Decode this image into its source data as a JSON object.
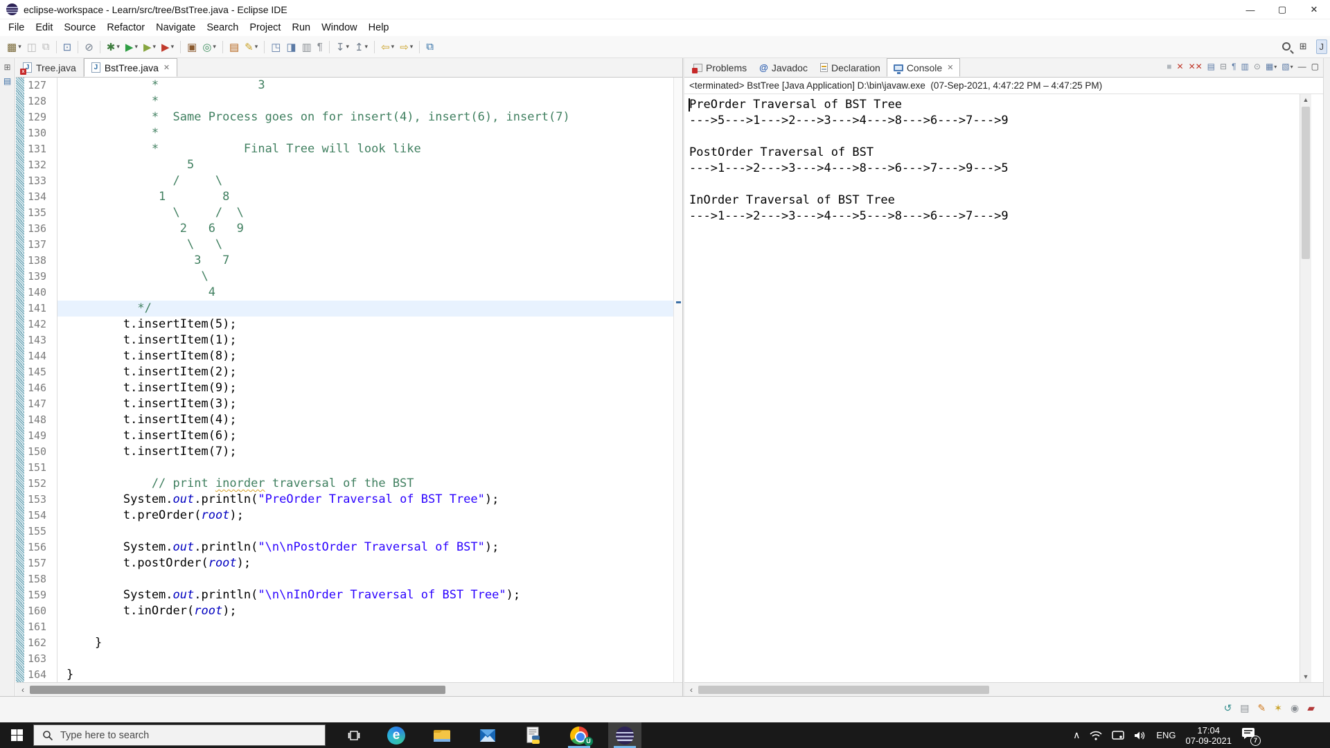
{
  "titlebar": {
    "title": "eclipse-workspace - Learn/src/tree/BstTree.java - Eclipse IDE"
  },
  "window_controls": {
    "minimize": "—",
    "maximize": "▢",
    "close": "✕"
  },
  "menus": [
    "File",
    "Edit",
    "Source",
    "Refactor",
    "Navigate",
    "Search",
    "Project",
    "Run",
    "Window",
    "Help"
  ],
  "toolbar": [
    {
      "name": "new",
      "g": "▩",
      "c": "#7a6a3a",
      "dd": true
    },
    {
      "name": "save",
      "g": "◫",
      "c": "#b8b8b8"
    },
    {
      "name": "save-all",
      "g": "⧉",
      "c": "#b8b8b8"
    },
    {
      "sep": true
    },
    {
      "name": "open-console-tool",
      "g": "⊡",
      "c": "#5b7aa5"
    },
    {
      "sep": true
    },
    {
      "name": "skip-breakpoints",
      "g": "⊘",
      "c": "#6f7b8a"
    },
    {
      "sep": true
    },
    {
      "name": "debug",
      "g": "✱",
      "c": "#3e7d3e",
      "dd": true
    },
    {
      "name": "run",
      "g": "▶",
      "c": "#2f9e44",
      "dd": true
    },
    {
      "name": "coverage",
      "g": "▶",
      "c": "#86a53f",
      "dd": true
    },
    {
      "name": "profile",
      "g": "▶",
      "c": "#c0392b",
      "dd": true
    },
    {
      "sep": true
    },
    {
      "name": "new-java-project",
      "g": "▣",
      "c": "#8a5a2e"
    },
    {
      "name": "new-class",
      "g": "◎",
      "c": "#3f8f5f",
      "dd": true
    },
    {
      "sep": true
    },
    {
      "name": "open-task",
      "g": "▤",
      "c": "#b5651d"
    },
    {
      "name": "highlight",
      "g": "✎",
      "c": "#c9a227",
      "dd": true
    },
    {
      "sep": true
    },
    {
      "name": "snapshot",
      "g": "◳",
      "c": "#5b7aa5"
    },
    {
      "name": "pin-editor",
      "g": "◨",
      "c": "#5b7aa5"
    },
    {
      "name": "show-annotations",
      "g": "▥",
      "c": "#8a8f94"
    },
    {
      "name": "show-whitespace",
      "g": "¶",
      "c": "#8a8f94"
    },
    {
      "sep": true
    },
    {
      "name": "next-annotation",
      "g": "↧",
      "c": "#6f7b8a",
      "dd": true
    },
    {
      "name": "prev-annotation",
      "g": "↥",
      "c": "#6f7b8a",
      "dd": true
    },
    {
      "sep": true
    },
    {
      "name": "back",
      "g": "⇦",
      "c": "#c9a227",
      "dd": true
    },
    {
      "name": "forward",
      "g": "⇨",
      "c": "#c9a227",
      "dd": true
    },
    {
      "sep": true
    },
    {
      "name": "link-editor",
      "g": "⧉",
      "c": "#2e6da4"
    }
  ],
  "perspectives": {
    "open_label": "⊞",
    "java_label": "J"
  },
  "left_strip_icons": [
    {
      "name": "restore-panel",
      "g": "⊞",
      "c": "#666"
    },
    {
      "name": "package-explorer",
      "g": "▤",
      "c": "#3a6ea5"
    }
  ],
  "editor": {
    "tabs": [
      {
        "name": "tab-tree-java",
        "label": "Tree.java",
        "active": false,
        "error": true,
        "close": false
      },
      {
        "name": "tab-bsttree-java",
        "label": "BstTree.java",
        "active": true,
        "error": false,
        "close": true,
        "close_glyph": "✕"
      }
    ],
    "file_icon_letter": "J",
    "error_badge": "x",
    "current_line": 141,
    "lines": [
      {
        "n": 127,
        "segs": [
          [
            "cm",
            "            *              3"
          ]
        ]
      },
      {
        "n": 128,
        "segs": [
          [
            "cm",
            "            *"
          ]
        ]
      },
      {
        "n": 129,
        "segs": [
          [
            "cm",
            "            *  Same Process goes on for insert(4), insert(6), insert(7)"
          ]
        ]
      },
      {
        "n": 130,
        "segs": [
          [
            "cm",
            "            *"
          ]
        ]
      },
      {
        "n": 131,
        "segs": [
          [
            "cm",
            "            *            Final Tree will look like"
          ]
        ]
      },
      {
        "n": 132,
        "segs": [
          [
            "cm",
            "                 5"
          ]
        ]
      },
      {
        "n": 133,
        "segs": [
          [
            "cm",
            "               /     \\"
          ]
        ]
      },
      {
        "n": 134,
        "segs": [
          [
            "cm",
            "             1        8"
          ]
        ]
      },
      {
        "n": 135,
        "segs": [
          [
            "cm",
            "               \\     /  \\"
          ]
        ]
      },
      {
        "n": 136,
        "segs": [
          [
            "cm",
            "                2   6   9"
          ]
        ]
      },
      {
        "n": 137,
        "segs": [
          [
            "cm",
            "                 \\   \\"
          ]
        ]
      },
      {
        "n": 138,
        "segs": [
          [
            "cm",
            "                  3   7"
          ]
        ]
      },
      {
        "n": 139,
        "segs": [
          [
            "cm",
            "                   \\"
          ]
        ]
      },
      {
        "n": 140,
        "segs": [
          [
            "cm",
            "                    4"
          ]
        ]
      },
      {
        "n": 141,
        "segs": [
          [
            "cm",
            "          */"
          ]
        ]
      },
      {
        "n": 142,
        "segs": [
          [
            "pl",
            "        t.insertItem(5);"
          ]
        ]
      },
      {
        "n": 143,
        "segs": [
          [
            "pl",
            "        t.insertItem(1);"
          ]
        ]
      },
      {
        "n": 144,
        "segs": [
          [
            "pl",
            "        t.insertItem(8);"
          ]
        ]
      },
      {
        "n": 145,
        "segs": [
          [
            "pl",
            "        t.insertItem(2);"
          ]
        ]
      },
      {
        "n": 146,
        "segs": [
          [
            "pl",
            "        t.insertItem(9);"
          ]
        ]
      },
      {
        "n": 147,
        "segs": [
          [
            "pl",
            "        t.insertItem(3);"
          ]
        ]
      },
      {
        "n": 148,
        "segs": [
          [
            "pl",
            "        t.insertItem(4);"
          ]
        ]
      },
      {
        "n": 149,
        "segs": [
          [
            "pl",
            "        t.insertItem(6);"
          ]
        ]
      },
      {
        "n": 150,
        "segs": [
          [
            "pl",
            "        t.insertItem(7);"
          ]
        ]
      },
      {
        "n": 151,
        "segs": []
      },
      {
        "n": 152,
        "segs": [
          [
            "cm",
            "            // print "
          ],
          [
            "cmw",
            "inorder"
          ],
          [
            "cm",
            " traversal of the BST"
          ]
        ]
      },
      {
        "n": 153,
        "segs": [
          [
            "pl",
            "        System."
          ],
          [
            "fd",
            "out"
          ],
          [
            "pl",
            ".println("
          ],
          [
            "st",
            "\"PreOrder Traversal of BST Tree\""
          ],
          [
            "pl",
            ");"
          ]
        ]
      },
      {
        "n": 154,
        "segs": [
          [
            "pl",
            "        t.preOrder("
          ],
          [
            "fd",
            "root"
          ],
          [
            "pl",
            ");"
          ]
        ]
      },
      {
        "n": 155,
        "segs": []
      },
      {
        "n": 156,
        "segs": [
          [
            "pl",
            "        System."
          ],
          [
            "fd",
            "out"
          ],
          [
            "pl",
            ".println("
          ],
          [
            "st",
            "\"\\n\\nPostOrder Traversal of BST\""
          ],
          [
            "pl",
            ");"
          ]
        ]
      },
      {
        "n": 157,
        "segs": [
          [
            "pl",
            "        t.postOrder("
          ],
          [
            "fd",
            "root"
          ],
          [
            "pl",
            ");"
          ]
        ]
      },
      {
        "n": 158,
        "segs": []
      },
      {
        "n": 159,
        "segs": [
          [
            "pl",
            "        System."
          ],
          [
            "fd",
            "out"
          ],
          [
            "pl",
            ".println("
          ],
          [
            "st",
            "\"\\n\\nInOrder Traversal of BST Tree\""
          ],
          [
            "pl",
            ");"
          ]
        ]
      },
      {
        "n": 160,
        "segs": [
          [
            "pl",
            "        t.inOrder("
          ],
          [
            "fd",
            "root"
          ],
          [
            "pl",
            ");"
          ]
        ]
      },
      {
        "n": 161,
        "segs": []
      },
      {
        "n": 162,
        "segs": [
          [
            "pl",
            "    }"
          ]
        ]
      },
      {
        "n": 163,
        "segs": []
      },
      {
        "n": 164,
        "segs": [
          [
            "pl",
            "}"
          ]
        ]
      }
    ]
  },
  "views": {
    "tabs": [
      {
        "name": "tab-problems",
        "label": "Problems",
        "icon": "problems",
        "active": false
      },
      {
        "name": "tab-javadoc",
        "label": "Javadoc",
        "icon": "javadoc",
        "active": false
      },
      {
        "name": "tab-declaration",
        "label": "Declaration",
        "icon": "declaration",
        "active": false
      },
      {
        "name": "tab-console",
        "label": "Console",
        "icon": "console",
        "active": true,
        "close": true,
        "close_glyph": "✕"
      }
    ],
    "javadoc_glyph": "@",
    "console_toolbar": [
      {
        "name": "terminate",
        "g": "■",
        "c": "#b0b6bc"
      },
      {
        "name": "remove-launch",
        "g": "✕",
        "c": "#c0392b"
      },
      {
        "name": "remove-all-launches",
        "g": "✕✕",
        "c": "#c0392b"
      },
      {
        "name": "clear-console",
        "g": "▤",
        "c": "#5b7aa5"
      },
      {
        "name": "scroll-lock",
        "g": "⊟",
        "c": "#8a8f94"
      },
      {
        "name": "word-wrap",
        "g": "¶",
        "c": "#5b7aa5"
      },
      {
        "name": "show-stdout",
        "g": "▥",
        "c": "#5b7aa5"
      },
      {
        "name": "pin-console",
        "g": "⊙",
        "c": "#8a8f94"
      },
      {
        "name": "display-console",
        "g": "▦",
        "c": "#5b7aa5",
        "dd": true
      },
      {
        "name": "open-console",
        "g": "▧",
        "c": "#5b7aa5",
        "dd": true
      },
      {
        "name": "minimize-view",
        "g": "—",
        "c": "#444"
      },
      {
        "name": "maximize-view",
        "g": "▢",
        "c": "#444"
      }
    ],
    "status": "<terminated> BstTree [Java Application] D:\\bin\\javaw.exe  (07-Sep-2021, 4:47:22 PM – 4:47:25 PM)",
    "output": [
      "PreOrder Traversal of BST Tree",
      "--->5--->1--->2--->3--->4--->8--->6--->7--->9",
      "",
      "PostOrder Traversal of BST",
      "--->1--->2--->3--->4--->8--->6--->7--->9--->5",
      "",
      "InOrder Traversal of BST Tree",
      "--->1--->2--->3--->4--->5--->8--->6--->7--->9"
    ]
  },
  "scrollbars": {
    "left_arrow": "‹",
    "up_arrow": "▲",
    "down_arrow": "▼"
  },
  "statusbar_icons": [
    {
      "name": "sync-view",
      "g": "↺",
      "c": "#2e8a8a"
    },
    {
      "name": "overview",
      "g": "▤",
      "c": "#8a8f94"
    },
    {
      "name": "edit-mode",
      "g": "✎",
      "c": "#d07a1f"
    },
    {
      "name": "smart-insert",
      "g": "✶",
      "c": "#c9a227"
    },
    {
      "name": "progress",
      "g": "◉",
      "c": "#8a8f94"
    },
    {
      "name": "perspective-mini",
      "g": "▰",
      "c": "#b33939"
    }
  ],
  "taskbar": {
    "search_placeholder": "Type here to search",
    "apps": [
      {
        "name": "edge",
        "running": false
      },
      {
        "name": "file-explorer",
        "running": false
      },
      {
        "name": "mail",
        "running": false
      },
      {
        "name": "python-document",
        "running": false
      },
      {
        "name": "chrome",
        "running": true,
        "badge": "U"
      },
      {
        "name": "eclipse",
        "running": true,
        "active": true
      }
    ],
    "tray": {
      "chevron": "∧",
      "language": "ENG",
      "time": "17:04",
      "date": "07-09-2021",
      "notification_count": "7"
    }
  }
}
